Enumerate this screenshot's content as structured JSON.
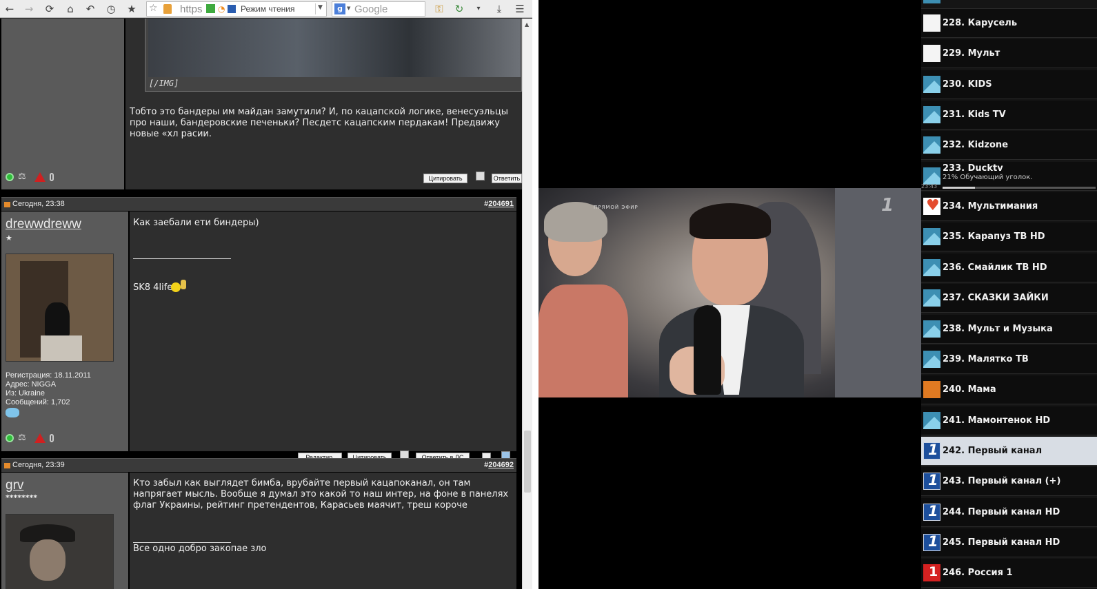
{
  "browser": {
    "url_text": "https",
    "reader_mode": "Режим чтения",
    "search_placeholder": "Google"
  },
  "posts": [
    {
      "img_tag": "[/IMG]",
      "text": "Тобто это бандеры им майдан замутили? И, по кацапской логике, венесуэльцы про наши, бандеровские печеньки? Песдетс кацапским пердакам! Предвижу новые «хл расии.",
      "quote_label": "Цитировать",
      "reply_label": "Ответить"
    },
    {
      "date": "Сегодня, 23:38",
      "number_prefix": "#",
      "number": "204691",
      "username": "drewwdreww",
      "stars": "★",
      "text": "Как заебали ети биндеры)",
      "signature": "SK8 4life",
      "info": {
        "reg": "Регистрация: 18.11.2011",
        "addr": "Адрес: NIGGA",
        "from": "Из: Ukraine",
        "msgs": "Сообщений: 1,702"
      },
      "edit_label": "Редактир.",
      "quote_label": "Цитировать",
      "reply_pm_label": "Ответить в ЛС"
    },
    {
      "date": "Сегодня, 23:39",
      "number_prefix": "#",
      "number": "204692",
      "username": "grv",
      "stars": "********",
      "text": "Кто забыл как выглядет бимба, врубайте первый кацапоканал, он там напрягает мысль. Вообще я думал это какой то наш интер, на фоне в панелях флаг Украины, рейтинг претендентов, Карасьев маячит, треш короче",
      "signature": "Все одно добро закопае зло"
    }
  ],
  "video": {
    "live_label": "ПРЯМОЙ ЭФИР"
  },
  "channels": [
    {
      "name": "228. Карусель",
      "logo": "white"
    },
    {
      "name": "229. Мульт",
      "logo": "white"
    },
    {
      "name": "230. KIDS",
      "logo": "blue"
    },
    {
      "name": "231. Kids TV",
      "logo": "blue"
    },
    {
      "name": "232. Kidzone",
      "logo": "blue"
    },
    {
      "name": "233. Ducktv",
      "logo": "blue",
      "sub": "21% Обучающий уголок.",
      "time": "23:43",
      "progress": 0.21
    },
    {
      "name": "234. Мультимания",
      "logo": "mm"
    },
    {
      "name": "235. Карапуз ТВ HD",
      "logo": "blue"
    },
    {
      "name": "236. Смайлик ТВ HD",
      "logo": "blue"
    },
    {
      "name": "237. СКАЗКИ ЗАЙКИ",
      "logo": "blue"
    },
    {
      "name": "238. Мульт и Музыка",
      "logo": "blue"
    },
    {
      "name": "239. Малятко ТВ",
      "logo": "blue"
    },
    {
      "name": "240. Мама",
      "logo": "orange"
    },
    {
      "name": "241. Мамонтенок HD",
      "logo": "blue"
    },
    {
      "name": "242. Первый канал",
      "logo": "pk",
      "active": true
    },
    {
      "name": "243. Первый канал (+)",
      "logo": "pk"
    },
    {
      "name": "244. Первый канал HD",
      "logo": "pk"
    },
    {
      "name": "245. Первый канал HD",
      "logo": "pk"
    },
    {
      "name": "246. Россия 1",
      "logo": "red"
    }
  ]
}
